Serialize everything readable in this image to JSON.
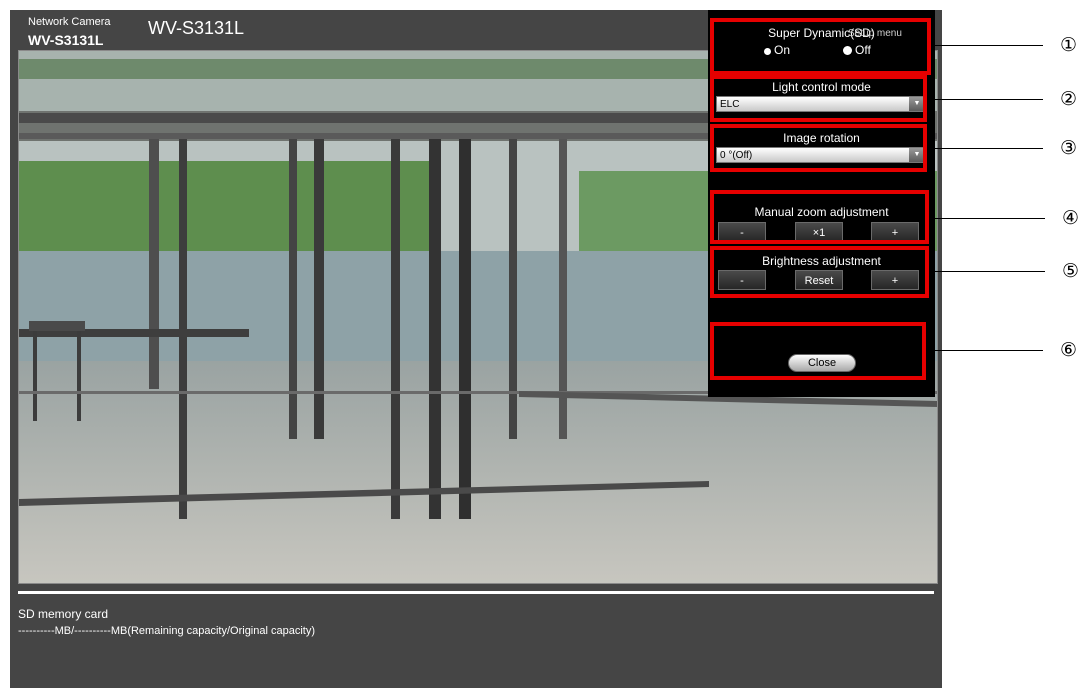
{
  "header": {
    "brand_top": "Network Camera",
    "brand_model": "WV-S3131L",
    "title": "WV-S3131L",
    "setup_link": "Setup menu"
  },
  "footer": {
    "sd_label": "SD memory card",
    "sd_capacity": "----------MB/----------MB(Remaining capacity/Original capacity)"
  },
  "panel": {
    "super_dynamic": {
      "title": "Super Dynamic(SD)",
      "on": "On",
      "off": "Off",
      "selected": "On"
    },
    "light_control": {
      "title": "Light control mode",
      "value": "ELC"
    },
    "image_rotation": {
      "title": "Image rotation",
      "value": "0 °(Off)"
    },
    "zoom": {
      "title": "Manual zoom adjustment",
      "minus": "-",
      "x1": "×1",
      "plus": "+"
    },
    "brightness": {
      "title": "Brightness adjustment",
      "minus": "-",
      "reset": "Reset",
      "plus": "+"
    },
    "close": "Close"
  },
  "callouts": [
    "①",
    "②",
    "③",
    "④",
    "⑤",
    "⑥"
  ],
  "colors": {
    "highlight": "#e60000",
    "panel_bg": "#000000",
    "app_bg": "#454545"
  }
}
